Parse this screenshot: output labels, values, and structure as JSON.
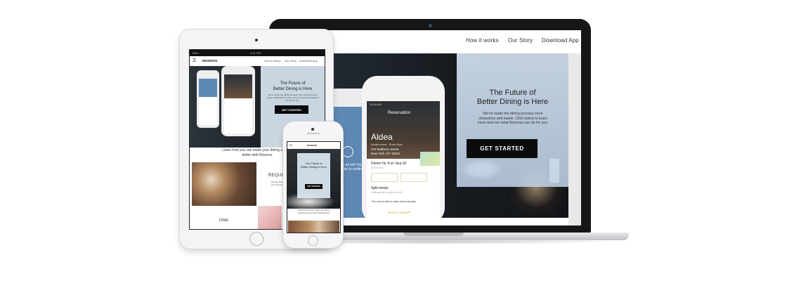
{
  "laptop": {
    "nav": {
      "how_it_works": "How it works",
      "our_story": "Our Story",
      "download_app": "Download App"
    },
    "hero": {
      "title_line1": "The Future of",
      "title_line2": "Better Dining is Here",
      "subtitle_line1": "We've made the dining process more",
      "subtitle_line2": "streamline and easier. Click below to learn",
      "subtitle_line3": "more and see what Reserve can do for you.",
      "cta": "GET STARTED"
    },
    "phone_mockup": {
      "status_time": "11:49 AM",
      "header": "Reservation",
      "restaurant": "Aldea",
      "cuisine": "Mediterranean · Winter Style",
      "address_line1": "270 Mulberry Street",
      "address_line2": "New York, NY 10012",
      "booking": "Dinner for 4 on Sep 30",
      "booking_time": "at 8:30 PM",
      "split_menu": "Split meals",
      "split_note": "Invite guests to split your bill",
      "check_note": "The check will be paid automatically",
      "link": "Need to cancel?"
    },
    "back_phone": {
      "confirm_text": "You're all set! Your reservation is confirmed"
    }
  },
  "tablet": {
    "status": {
      "carrier": "BELL",
      "time": "4:21 PM"
    },
    "nav": {
      "brand": "RESERVE",
      "how_it_works": "How it Works",
      "our_story": "Our Story",
      "download_app": "Download App"
    },
    "hero": {
      "title_line1": "The Future of",
      "title_line2": "Better Dining is Here",
      "subtitle": "We've made the dining process more streamline and easier. Click below to learn more and see what Reserve can do for you.",
      "cta": "GET STARTED"
    },
    "learn_line1": "Learn how you can make your dining experie",
    "learn_line2": "better with Reserve",
    "request_heading": "REQUE",
    "request_text": "Browse local restaurants by location, reservation and your favorite dishes so you can request an open table.",
    "dine_heading": "DINE"
  },
  "phone": {
    "brand": "RESERVE",
    "hero": {
      "title_line1": "The Future of",
      "title_line2": "Better Dining is Here",
      "cta": "GET STARTED"
    },
    "learn_line1": "Learn how you can make your dining",
    "learn_line2": "experience even better with Reserve"
  },
  "colors": {
    "cta_bg": "#0b0b0b",
    "panel": "#d2e1f0",
    "device_frame": "#161616",
    "accent_green": "#7cc58a",
    "accent_gold": "#d4a84a"
  }
}
